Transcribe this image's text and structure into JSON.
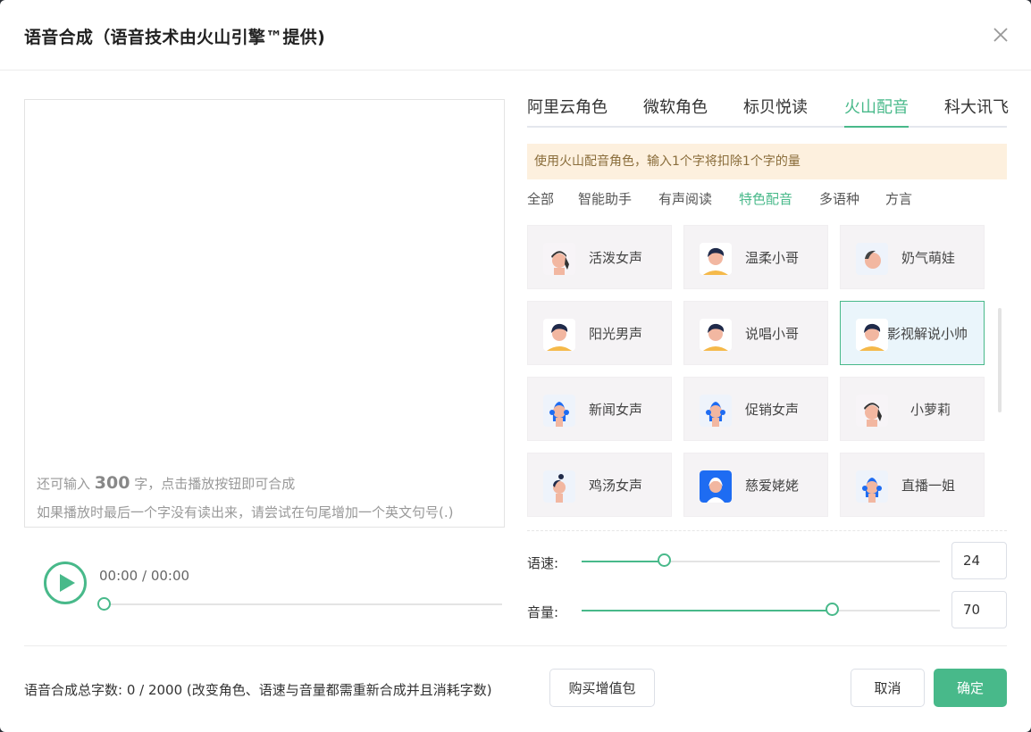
{
  "dialog": {
    "title": "语音合成（语音技术由火山引擎™提供)"
  },
  "editor": {
    "text_value": "",
    "hint_prefix": "还可输入",
    "remaining": "300",
    "hint_suffix": "字，点击播放按钮即可合成",
    "hint_line2": "如果播放时最后一个字没有读出来，请尝试在句尾增加一个英文句号(.)"
  },
  "player": {
    "time": "00:00 / 00:00",
    "progress": 0
  },
  "provider_tabs": [
    {
      "label": "阿里云角色",
      "active": false
    },
    {
      "label": "微软角色",
      "active": false
    },
    {
      "label": "标贝悦读",
      "active": false
    },
    {
      "label": "火山配音",
      "active": true
    },
    {
      "label": "科大讯飞",
      "active": false
    }
  ],
  "notice": "使用火山配音角色，输入1个字将扣除1个字的量",
  "category_tabs": [
    {
      "label": "全部",
      "active": false
    },
    {
      "label": "智能助手",
      "active": false
    },
    {
      "label": "有声阅读",
      "active": false
    },
    {
      "label": "特色配音",
      "active": true
    },
    {
      "label": "多语种",
      "active": false
    },
    {
      "label": "方言",
      "active": false
    }
  ],
  "voices": [
    {
      "name": "活泼女声",
      "avatar": "female-braid-avatar",
      "selected": false
    },
    {
      "name": "温柔小哥",
      "avatar": "male-avatar",
      "selected": false
    },
    {
      "name": "奶气萌娃",
      "avatar": "child-avatar",
      "selected": false
    },
    {
      "name": "阳光男声",
      "avatar": "male-avatar",
      "selected": false
    },
    {
      "name": "说唱小哥",
      "avatar": "male-avatar",
      "selected": false
    },
    {
      "name": "影视解说小帅",
      "avatar": "male-avatar",
      "selected": true
    },
    {
      "name": "新闻女声",
      "avatar": "female-headset-avatar",
      "selected": false
    },
    {
      "name": "促销女声",
      "avatar": "female-headset-avatar",
      "selected": false
    },
    {
      "name": "小萝莉",
      "avatar": "female-braid-avatar",
      "selected": false
    },
    {
      "name": "鸡汤女声",
      "avatar": "female-bun-avatar",
      "selected": false
    },
    {
      "name": "慈爱姥姥",
      "avatar": "grandma-avatar",
      "selected": false
    },
    {
      "name": "直播一姐",
      "avatar": "female-headset-avatar",
      "selected": false
    }
  ],
  "speed": {
    "label": "语速:",
    "value": "24",
    "level": 0.23
  },
  "volume": {
    "label": "音量:",
    "value": "70",
    "level": 0.7
  },
  "footer": {
    "total_text": "语音合成总字数:  0 / 2000  (改变角色、语速与音量都需重新合成并且消耗字数)",
    "buy_label": "购买增值包",
    "cancel_label": "取消",
    "confirm_label": "确定"
  },
  "colors": {
    "accent": "#48b98a",
    "notice_bg": "#fdf0de",
    "notice_text": "#8a6d3b"
  }
}
